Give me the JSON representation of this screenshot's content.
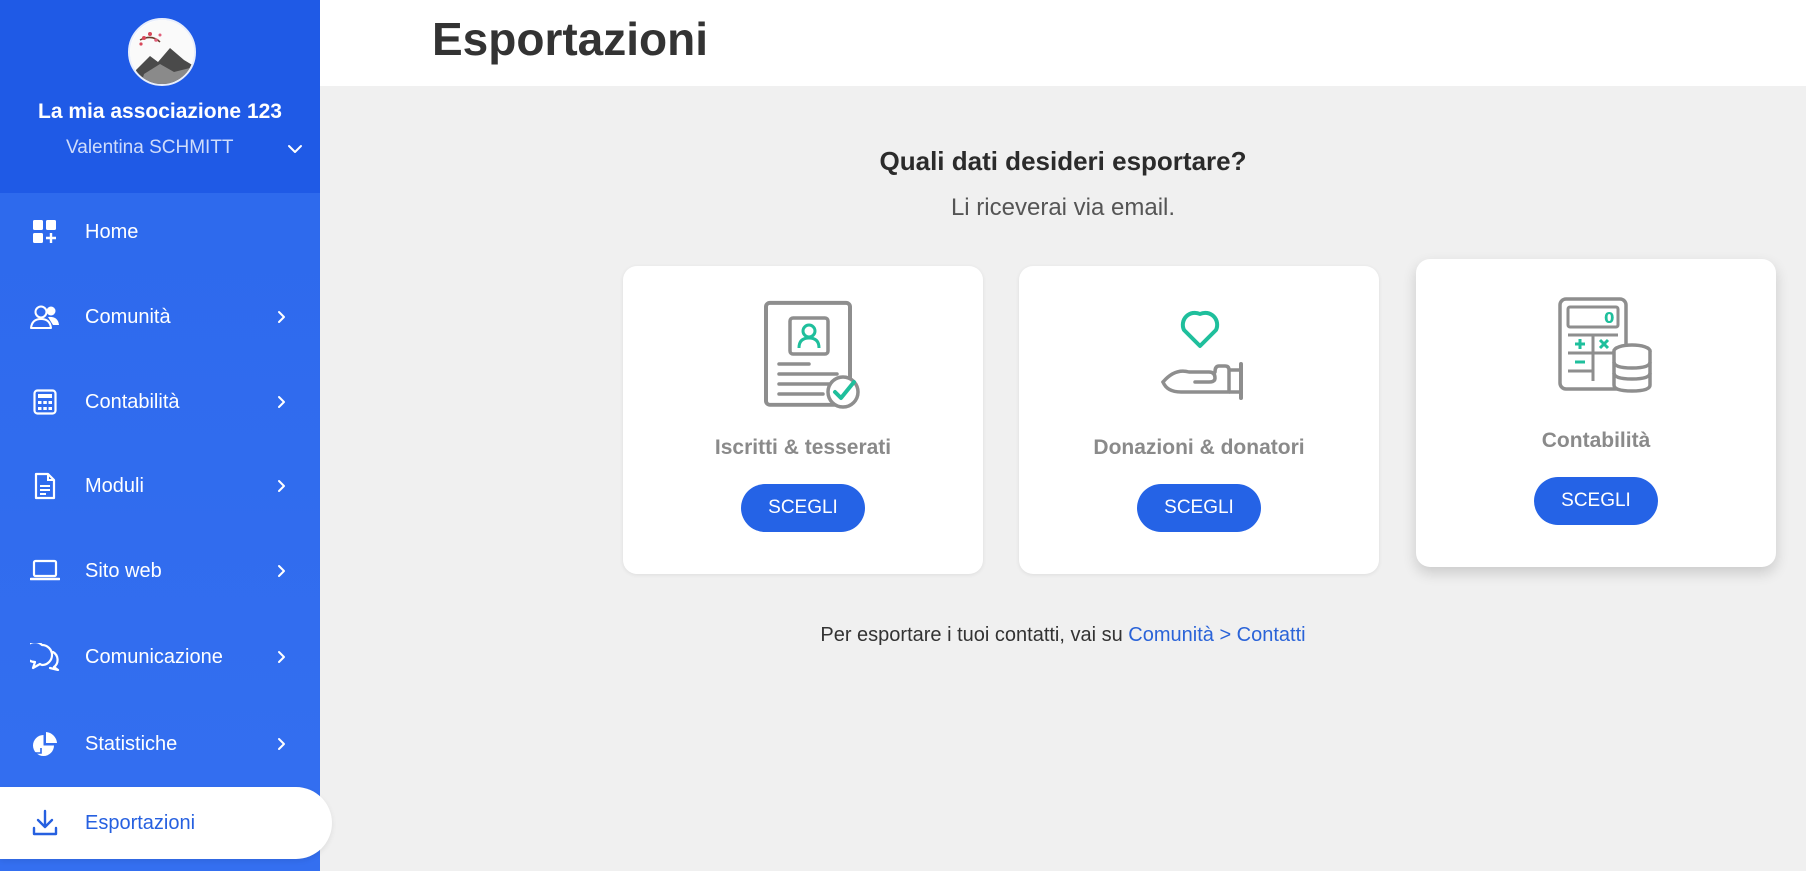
{
  "sidebar": {
    "org_name": "La mia associazione 123",
    "user_name": "Valentina SCHMITT",
    "items": [
      {
        "label": "Home",
        "icon": "dashboard-icon"
      },
      {
        "label": "Comunità",
        "icon": "users-icon"
      },
      {
        "label": "Contabilità",
        "icon": "calculator-icon"
      },
      {
        "label": "Moduli",
        "icon": "document-icon"
      },
      {
        "label": "Sito web",
        "icon": "laptop-icon"
      },
      {
        "label": "Comunicazione",
        "icon": "chat-icon"
      },
      {
        "label": "Statistiche",
        "icon": "pie-chart-icon"
      },
      {
        "label": "Esportazioni",
        "icon": "download-icon"
      }
    ]
  },
  "header": {
    "title": "Esportazioni"
  },
  "main": {
    "question": "Quali dati desideri esportare?",
    "subtitle": "Li riceverai via email.",
    "cards": [
      {
        "title": "Iscritti & tesserati",
        "button": "SCEGLI",
        "icon": "member-card-icon"
      },
      {
        "title": "Donazioni & donatori",
        "button": "SCEGLI",
        "icon": "heart-hand-icon"
      },
      {
        "title": "Contabilità",
        "button": "SCEGLI",
        "icon": "calculator-coins-icon"
      }
    ],
    "footnote_text": "Per esportare i tuoi contatti, vai su ",
    "footnote_link": "Comunità > Contatti"
  },
  "colors": {
    "sidebar": "#2c68ec",
    "accent": "#2563e6",
    "teal": "#1fbf9c",
    "background": "#f0f0f0"
  }
}
